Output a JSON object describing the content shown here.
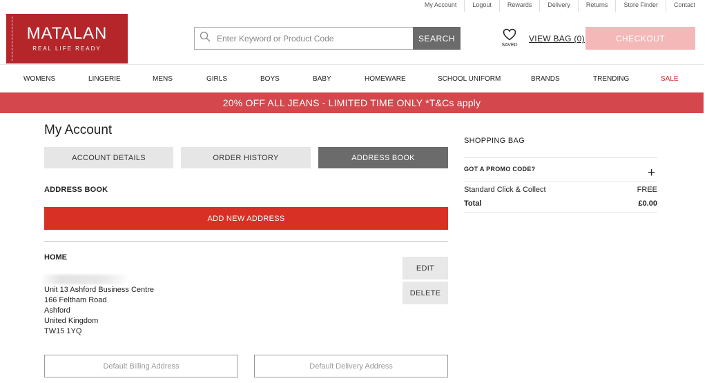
{
  "utility_links": [
    "My Account",
    "Logout",
    "Rewards",
    "Delivery",
    "Returns",
    "Store Finder",
    "Contact"
  ],
  "logo": {
    "brand": "MATALAN",
    "tagline": "REAL LIFE READY"
  },
  "search": {
    "placeholder": "Enter Keyword or Product Code",
    "button_label": "SEARCH"
  },
  "saved_label": "SAVED",
  "view_bag_label": "VIEW BAG (0)",
  "checkout_label": "CHECKOUT",
  "nav": [
    "WOMENS",
    "LINGERIE",
    "MENS",
    "GIRLS",
    "BOYS",
    "BABY",
    "HOMEWARE",
    "SCHOOL UNIFORM",
    "BRANDS",
    "TRENDING",
    "SALE"
  ],
  "banner_text": "20% OFF ALL JEANS - LIMITED TIME ONLY *T&Cs apply",
  "page_title": "My Account",
  "tabs": [
    {
      "label": "ACCOUNT DETAILS",
      "active": false
    },
    {
      "label": "ORDER HISTORY",
      "active": false
    },
    {
      "label": "ADDRESS BOOK",
      "active": true
    }
  ],
  "address_book": {
    "title": "ADDRESS BOOK",
    "add_button_label": "ADD NEW ADDRESS",
    "entry": {
      "label": "HOME",
      "lines": [
        "Unit 13 Ashford Business Centre",
        "166 Feltham Road",
        "Ashford",
        "United Kingdom",
        "TW15 1YQ"
      ],
      "edit_label": "EDIT",
      "delete_label": "DELETE"
    },
    "default_billing_label": "Default Billing Address",
    "default_delivery_label": "Default Delivery Address"
  },
  "sidebar": {
    "title": "SHOPPING BAG",
    "promo_label": "GOT A PROMO CODE?",
    "delivery_method": "Standard Click & Collect",
    "delivery_price": "FREE",
    "total_label": "Total",
    "total_value": "£0.00"
  },
  "colors": {
    "brand_red": "#b5262b",
    "banner_red": "#d4474d",
    "add_button_red": "#d93025",
    "checkout_pink": "#f4b8b8",
    "active_tab": "#6b6b6b"
  }
}
